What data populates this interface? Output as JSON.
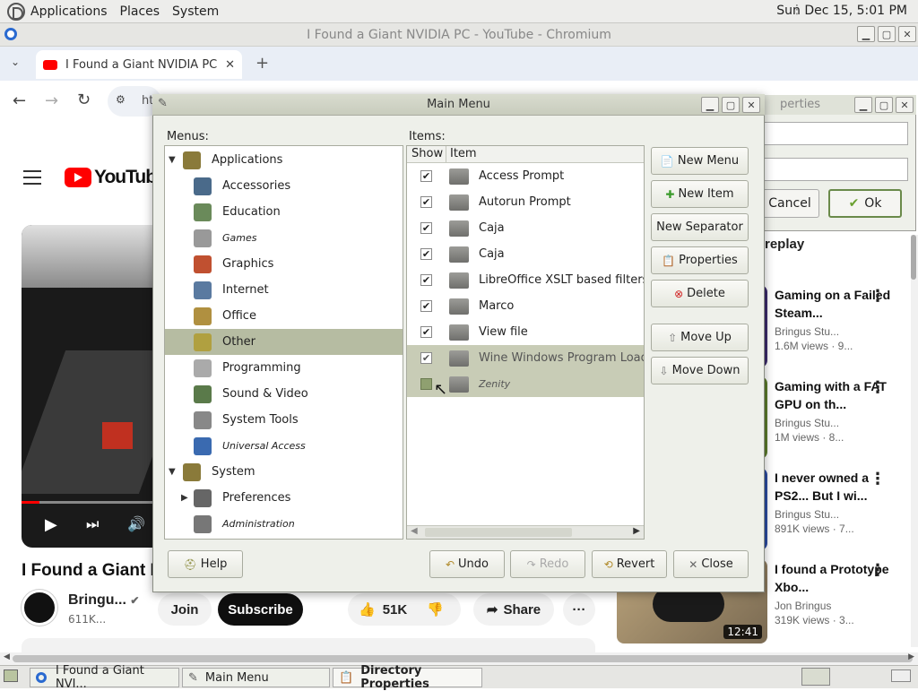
{
  "top_panel": {
    "menus": [
      "Applications",
      "Places",
      "System"
    ],
    "clock": "Sun Dec 15,  5:01 PM"
  },
  "browser": {
    "window_title": "I Found a Giant NVIDIA PC - YouTube - Chromium",
    "tab_title": "I Found a Giant NVIDIA PC - Y",
    "new_tab": "+",
    "url_fragment": "ht"
  },
  "youtube": {
    "logo_text": "YouTube",
    "video_title": "I Found a Giant N",
    "channel": "Bringu...",
    "subscribers": "611K...",
    "join": "Join",
    "subscribe": "Subscribe",
    "likes": "51K",
    "share": "Share",
    "more": "···",
    "recommendations": [
      {
        "title": "Gaming on a Failed Steam...",
        "channel": "Bringus Stu...",
        "views": "1.6M views · 9..."
      },
      {
        "title": "Gaming with a FAT GPU on th...",
        "channel": "Bringus Stu...",
        "views": "1M views · 8..."
      },
      {
        "title": "I never owned a PS2... But I wi...",
        "channel": "Bringus Stu...",
        "views": "891K views · 7..."
      },
      {
        "title": "I found a Prototype Xbo...",
        "channel": "Jon Bringus",
        "views": "319K views · 3..."
      }
    ],
    "partial_text": "replay",
    "thumb_duration": "12:41"
  },
  "directory_properties": {
    "title": "Directory Properties",
    "title_partial": "perties",
    "cancel": "Cancel",
    "ok": "Ok"
  },
  "main_menu": {
    "title": "Main Menu",
    "menus_label": "Menus:",
    "items_label": "Items:",
    "col_show": "Show",
    "col_item": "Item",
    "tree": [
      {
        "label": "Applications",
        "level": 0,
        "expanded": true,
        "italic": false,
        "color": "#8a7a3a"
      },
      {
        "label": "Accessories",
        "level": 1,
        "italic": false,
        "color": "#4a6a8a"
      },
      {
        "label": "Education",
        "level": 1,
        "italic": false,
        "color": "#6a8a5a"
      },
      {
        "label": "Games",
        "level": 1,
        "italic": true,
        "color": "#999999"
      },
      {
        "label": "Graphics",
        "level": 1,
        "italic": false,
        "color": "#c05030"
      },
      {
        "label": "Internet",
        "level": 1,
        "italic": false,
        "color": "#5a7aa0"
      },
      {
        "label": "Office",
        "level": 1,
        "italic": false,
        "color": "#b09040"
      },
      {
        "label": "Other",
        "level": 1,
        "italic": false,
        "selected": true,
        "color": "#b0a040"
      },
      {
        "label": "Programming",
        "level": 1,
        "italic": false,
        "color": "#aaaaaa"
      },
      {
        "label": "Sound & Video",
        "level": 1,
        "italic": false,
        "color": "#5a7a4a"
      },
      {
        "label": "System Tools",
        "level": 1,
        "italic": false,
        "color": "#888888"
      },
      {
        "label": "Universal Access",
        "level": 1,
        "italic": true,
        "color": "#3a6ab0"
      },
      {
        "label": "System",
        "level": 0,
        "expanded": true,
        "italic": false,
        "color": "#8a7a3a"
      },
      {
        "label": "Preferences",
        "level": 1,
        "italic": false,
        "collapsed": true,
        "color": "#666666"
      },
      {
        "label": "Administration",
        "level": 1,
        "italic": true,
        "color": "#777777"
      }
    ],
    "items": [
      {
        "label": "Access Prompt",
        "checked": true
      },
      {
        "label": "Autorun Prompt",
        "checked": true
      },
      {
        "label": "Caja",
        "checked": true
      },
      {
        "label": "Caja",
        "checked": true
      },
      {
        "label": "LibreOffice XSLT based filters",
        "checked": true
      },
      {
        "label": "Marco",
        "checked": true
      },
      {
        "label": "View file",
        "checked": true
      },
      {
        "label": "Wine Windows Program Loader",
        "checked": true,
        "selected": true
      },
      {
        "label": "Zenity",
        "checked": false,
        "italic": true,
        "selected": true
      }
    ],
    "side_buttons": [
      "New Menu",
      "New Item",
      "New Separator",
      "Properties",
      "Delete",
      "Move Up",
      "Move Down"
    ],
    "help": "Help",
    "undo": "Undo",
    "redo": "Redo",
    "revert": "Revert",
    "close": "Close"
  },
  "taskbar": {
    "tasks": [
      "I Found a Giant NVI...",
      "Main Menu",
      "Directory Properties"
    ]
  }
}
